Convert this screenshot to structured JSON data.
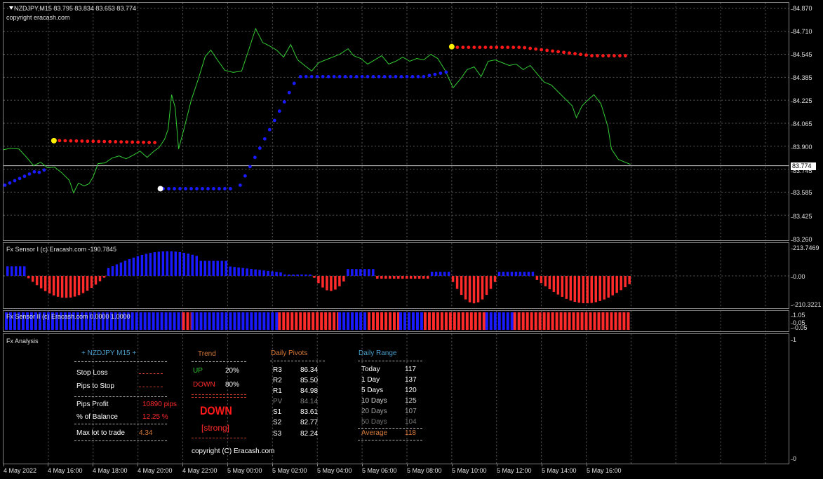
{
  "main": {
    "title": "NZDJPY,M15  83.795 83.834 83.653 83.774",
    "copyright": "copyright eracash.com",
    "price_axis": [
      "84.870",
      "84.710",
      "84.545",
      "84.385",
      "84.225",
      "84.065",
      "83.900",
      "83.745",
      "83.585",
      "83.425",
      "83.260"
    ],
    "current_price": "83.774"
  },
  "sensor1": {
    "title": "Fx Sensor I (c) Eracash.com -190.7845",
    "axis": [
      "213.7469",
      "0.00",
      "-210.3221"
    ]
  },
  "sensor2": {
    "title": "Fx Sensor II (c) Eracash.com 0.0000 1.0000",
    "axis": [
      "1.05",
      "0.05",
      "-0.05"
    ]
  },
  "analysis": {
    "title": "Fx Analysis",
    "axis": [
      "1",
      "0"
    ],
    "symbol": "+  NZDJPY  M15  +",
    "stop_loss_label": "Stop Loss",
    "pips_to_stop_label": "Pips to Stop",
    "pips_profit_label": "Pips Profit",
    "pips_profit_value": "10890 pips",
    "balance_label": "% of Balance",
    "balance_value": "12.25 %",
    "max_lot_label": "Max lot to trade",
    "max_lot_value": "4.34",
    "trend": {
      "title": "Trend",
      "up_label": "UP",
      "up_value": "20%",
      "down_label": "DOWN",
      "down_value": "80%",
      "signal": "DOWN",
      "strength": "[strong]"
    },
    "pivots": {
      "title": "Daily Pivots",
      "rows": [
        {
          "label": "R3",
          "value": "86.34"
        },
        {
          "label": "R2",
          "value": "85.50"
        },
        {
          "label": "R1",
          "value": "84.98"
        },
        {
          "label": "PV",
          "value": "84.14"
        },
        {
          "label": "S1",
          "value": "83.61"
        },
        {
          "label": "S2",
          "value": "82.77"
        },
        {
          "label": "S3",
          "value": "82.24"
        }
      ]
    },
    "range": {
      "title": "Daily Range",
      "rows": [
        {
          "label": "Today",
          "value": "117"
        },
        {
          "label": "1 Day",
          "value": "137"
        },
        {
          "label": "5 Days",
          "value": "120"
        },
        {
          "label": "10 Days",
          "value": "125"
        },
        {
          "label": "20 Days",
          "value": "107"
        },
        {
          "label": "50 Days",
          "value": "104"
        }
      ],
      "avg_label": "Average",
      "avg_value": "118"
    },
    "copyright": "copyright (C) Eracash.com"
  },
  "time_axis": [
    "4 May 2022",
    "4 May 16:00",
    "4 May 18:00",
    "4 May 20:00",
    "4 May 22:00",
    "5 May 00:00",
    "5 May 02:00",
    "5 May 04:00",
    "5 May 06:00",
    "5 May 08:00",
    "5 May 10:00",
    "5 May 12:00",
    "5 May 14:00",
    "5 May 16:00"
  ],
  "colors": {
    "price_line": "#33cc33",
    "support": "#1a1aff",
    "resistance": "#ff1a1a",
    "up": "#33cc33",
    "down": "#ff2a2a",
    "label_orange": "#d87a3a",
    "label_blue": "#4a9cc8"
  }
}
